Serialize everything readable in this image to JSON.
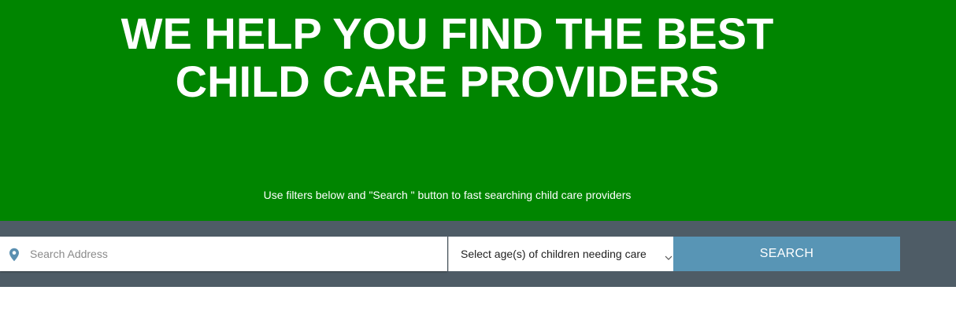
{
  "hero": {
    "title_line1": "WE HELP YOU FIND THE BEST",
    "title_line2": "CHILD CARE PROVIDERS",
    "subtitle": "Use filters below and \"Search \" button to fast searching child care providers"
  },
  "search": {
    "address_placeholder": "Search Address",
    "address_icon": "map-pin-icon",
    "age_select_label": "Select age(s) of children needing care",
    "age_select_icon": "chevron-down-icon",
    "button_label": "SEARCH"
  },
  "colors": {
    "hero_background": "#008500",
    "search_band_background": "#4e5c66",
    "search_button": "#5895b5",
    "pin_icon": "#5a8fb0"
  }
}
